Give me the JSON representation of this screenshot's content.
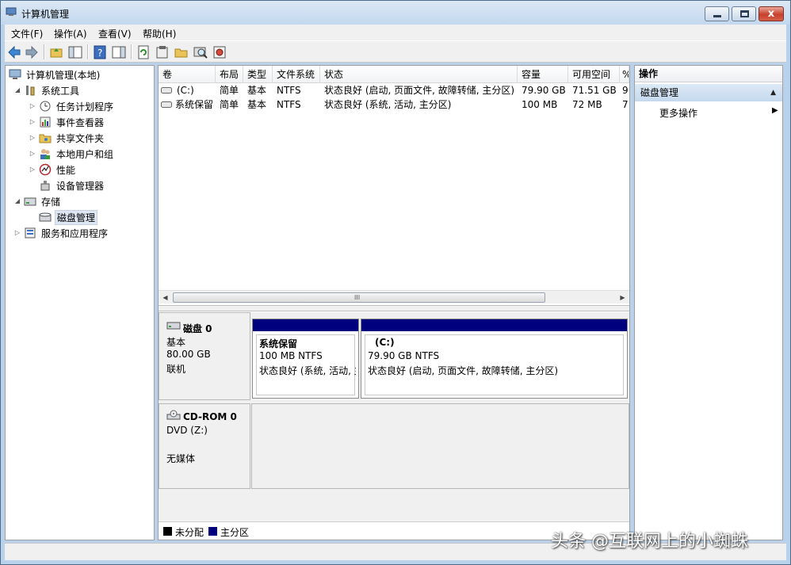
{
  "window": {
    "title": "计算机管理",
    "controls": {
      "close": "x"
    }
  },
  "menu": [
    "文件(F)",
    "操作(A)",
    "查看(V)",
    "帮助(H)"
  ],
  "toolbar": {
    "icons": [
      "back-arrow-icon",
      "forward-arrow-icon",
      "up-folder-icon",
      "show-hide-tree-icon",
      "help-icon",
      "show-action-pane-icon",
      "refresh-icon",
      "properties-icon",
      "open-folder-icon",
      "search-disk-icon",
      "disk-wizard-icon"
    ]
  },
  "tree": {
    "root": "计算机管理(本地)",
    "system_tools": "系统工具",
    "task_scheduler": "任务计划程序",
    "event_viewer": "事件查看器",
    "shared_folders": "共享文件夹",
    "local_users": "本地用户和组",
    "performance": "性能",
    "device_manager": "设备管理器",
    "storage": "存储",
    "disk_management": "磁盘管理",
    "services_apps": "服务和应用程序"
  },
  "volume_list": {
    "columns": [
      "卷",
      "布局",
      "类型",
      "文件系统",
      "状态",
      "容量",
      "可用空间",
      "%"
    ],
    "rows": [
      {
        "volume": "(C:)",
        "layout": "简单",
        "type": "基本",
        "fs": "NTFS",
        "status": "状态良好 (启动, 页面文件, 故障转储, 主分区)",
        "capacity": "79.90 GB",
        "free": "71.51 GB",
        "pct": "9"
      },
      {
        "volume": "系统保留",
        "layout": "简单",
        "type": "基本",
        "fs": "NTFS",
        "status": "状态良好 (系统, 活动, 主分区)",
        "capacity": "100 MB",
        "free": "72 MB",
        "pct": "7"
      }
    ],
    "scroll_grip": "III"
  },
  "disks": {
    "disk0": {
      "name": "磁盘 0",
      "type": "基本",
      "size": "80.00 GB",
      "state": "联机",
      "partitions": [
        {
          "name": "系统保留",
          "size": "100 MB NTFS",
          "status": "状态良好 (系统, 活动, 主分区)"
        },
        {
          "name": "(C:)",
          "size": "79.90 GB NTFS",
          "status": "状态良好 (启动, 页面文件, 故障转储, 主分区)"
        }
      ]
    },
    "cdrom0": {
      "name": "CD-ROM 0",
      "drive": "DVD (Z:)",
      "media": "无媒体"
    }
  },
  "legend": [
    {
      "label": "未分配",
      "color": "#000000"
    },
    {
      "label": "主分区",
      "color": "#00007f"
    }
  ],
  "actions": {
    "header": "操作",
    "section": "磁盘管理",
    "more": "更多操作"
  },
  "watermark": "头条 @互联网上的小蜘蛛"
}
